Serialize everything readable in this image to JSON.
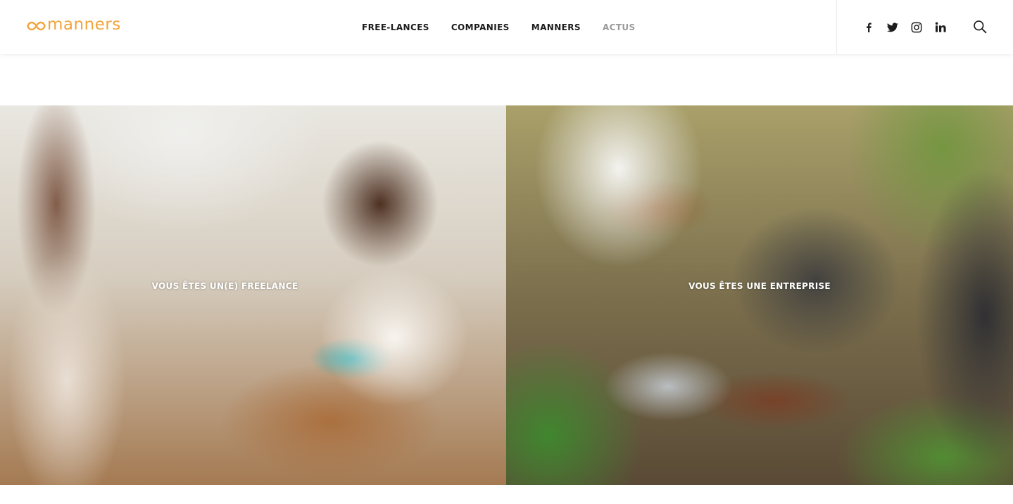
{
  "brand": {
    "name": "manners",
    "accent_color": "#f2a43c",
    "logo_icon": "infinity-icon"
  },
  "nav": {
    "items": [
      {
        "label": "FREE-LANCES",
        "state": "default"
      },
      {
        "label": "COMPANIES",
        "state": "default"
      },
      {
        "label": "MANNERS",
        "state": "default"
      },
      {
        "label": "ACTUS",
        "state": "muted"
      }
    ]
  },
  "social": {
    "icons": [
      "facebook-icon",
      "twitter-icon",
      "instagram-icon",
      "linkedin-icon"
    ]
  },
  "search": {
    "icon": "search-icon"
  },
  "hero": {
    "panels": [
      {
        "label": "VOUS ÊTES UN(E) FREELANCE"
      },
      {
        "label": "VOUS ÊTES UNE ENTREPRISE"
      }
    ]
  }
}
